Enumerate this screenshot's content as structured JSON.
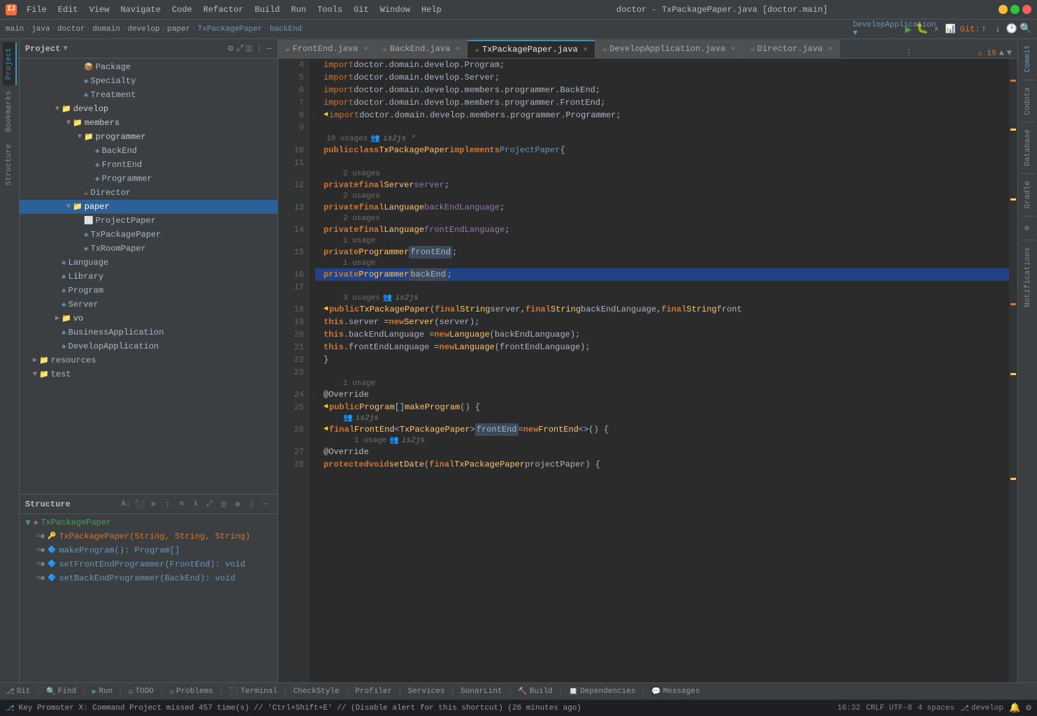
{
  "titleBar": {
    "title": "doctor - TxPackagePaper.java [doctor.main]",
    "menus": [
      "File",
      "Edit",
      "View",
      "Navigate",
      "Code",
      "Refactor",
      "Build",
      "Run",
      "Tools",
      "Git",
      "Window",
      "Help"
    ]
  },
  "breadcrumb": {
    "items": [
      "main",
      "java",
      "doctor",
      "domain",
      "develop",
      "paper",
      "TxPackagePaper",
      "backEnd"
    ]
  },
  "tabs": [
    {
      "label": "FrontEnd.java",
      "active": false,
      "modified": false,
      "icon": "☕"
    },
    {
      "label": "BackEnd.java",
      "active": false,
      "modified": false,
      "icon": "☕"
    },
    {
      "label": "TxPackagePaper.java",
      "active": true,
      "modified": false,
      "icon": "☕"
    },
    {
      "label": "DevelopApplication.java",
      "active": false,
      "modified": false,
      "icon": "☕"
    },
    {
      "label": "Director.java",
      "active": false,
      "modified": false,
      "icon": "☕"
    }
  ],
  "sidebar": {
    "title": "Project",
    "treeItems": [
      {
        "label": "Package",
        "indent": 5,
        "icon": "📦",
        "type": "file"
      },
      {
        "label": "Specialty",
        "indent": 5,
        "icon": "🔷",
        "type": "interface"
      },
      {
        "label": "Treatment",
        "indent": 5,
        "icon": "🔷",
        "type": "interface"
      },
      {
        "label": "develop",
        "indent": 3,
        "icon": "📁",
        "type": "folder",
        "expanded": true
      },
      {
        "label": "members",
        "indent": 5,
        "icon": "📁",
        "type": "folder-blue",
        "expanded": true
      },
      {
        "label": "programmer",
        "indent": 7,
        "icon": "📁",
        "type": "folder",
        "expanded": true
      },
      {
        "label": "BackEnd",
        "indent": 9,
        "icon": "🔷",
        "type": "interface"
      },
      {
        "label": "FrontEnd",
        "indent": 9,
        "icon": "🔷",
        "type": "interface"
      },
      {
        "label": "Programmer",
        "indent": 9,
        "icon": "🔷",
        "type": "interface"
      },
      {
        "label": "Director",
        "indent": 7,
        "icon": "☕",
        "type": "java"
      },
      {
        "label": "paper",
        "indent": 5,
        "icon": "📁",
        "type": "folder",
        "expanded": true,
        "selected": true
      },
      {
        "label": "ProjectPaper",
        "indent": 7,
        "icon": "🔲",
        "type": "interface2"
      },
      {
        "label": "TxPackagePaper",
        "indent": 7,
        "icon": "🔷",
        "type": "interface",
        "selected": true
      },
      {
        "label": "TxRoomPaper",
        "indent": 7,
        "icon": "🔷",
        "type": "interface"
      },
      {
        "label": "Language",
        "indent": 3,
        "icon": "🔷",
        "type": "interface"
      },
      {
        "label": "Library",
        "indent": 3,
        "icon": "🔷",
        "type": "interface"
      },
      {
        "label": "Program",
        "indent": 3,
        "icon": "🔷",
        "type": "interface"
      },
      {
        "label": "Server",
        "indent": 3,
        "icon": "🔷",
        "type": "interface"
      },
      {
        "label": "vo",
        "indent": 3,
        "icon": "📁",
        "type": "folder",
        "expanded": false
      },
      {
        "label": "BusinessApplication",
        "indent": 3,
        "icon": "🔷",
        "type": "interface"
      },
      {
        "label": "DevelopApplication",
        "indent": 3,
        "icon": "🔷",
        "type": "interface"
      },
      {
        "label": "resources",
        "indent": 1,
        "icon": "📁",
        "type": "resources"
      },
      {
        "label": "test",
        "indent": 1,
        "icon": "📁",
        "type": "test",
        "expanded": false
      }
    ]
  },
  "structure": {
    "title": "Structure",
    "rootLabel": "TxPackagePaper",
    "items": [
      {
        "label": "TxPackagePaper(String, String, String)",
        "type": "constructor",
        "indent": 1
      },
      {
        "label": "makeProgram(): Program[]",
        "type": "method",
        "indent": 1
      },
      {
        "label": "setFrontEndProgrammer(FrontEnd): void",
        "type": "method-public",
        "indent": 1
      },
      {
        "label": "setBackEndProgrammer(BackEnd): void",
        "type": "method-public",
        "indent": 1
      }
    ]
  },
  "editor": {
    "filename": "TxPackagePaper.java",
    "warningCount": 19,
    "lines": [
      {
        "num": 4,
        "meta": null,
        "code": "import",
        "codeFull": "    import doctor.domain.develop.Program;"
      },
      {
        "num": 5,
        "meta": null,
        "codeFull": "    import doctor.domain.develop.Server;"
      },
      {
        "num": 6,
        "meta": null,
        "codeFull": "    import doctor.domain.develop.members.programmer.BackEnd;"
      },
      {
        "num": 7,
        "meta": null,
        "codeFull": "    import doctor.domain.develop.members.programmer.FrontEnd;"
      },
      {
        "num": 8,
        "meta": null,
        "codeFull": "    import doctor.domain.develop.members.programmer.Programmer;"
      },
      {
        "num": 9,
        "meta": null,
        "codeFull": ""
      },
      {
        "num": 10,
        "meta": "10 usages  is2js *",
        "codeFull": "public class TxPackagePaper implements ProjectPaper {"
      },
      {
        "num": 11,
        "meta": null,
        "codeFull": ""
      },
      {
        "num": 12,
        "meta": "2 usages",
        "codeFull": "    private final Server server;"
      },
      {
        "num": 13,
        "meta": "2 usages",
        "codeFull": "    private final Language backEndLanguage;"
      },
      {
        "num": 14,
        "meta": "2 usages",
        "codeFull": "    private final Language frontEndLanguage;"
      },
      {
        "num": 15,
        "meta": "1 usage",
        "codeFull": "    private Programmer frontEnd;"
      },
      {
        "num": 16,
        "meta": "1 usage",
        "codeFull": "    private Programmer backEnd;"
      },
      {
        "num": 17,
        "meta": null,
        "codeFull": ""
      },
      {
        "num": 18,
        "meta": "3 usages  is2js",
        "codeFull": "    public TxPackagePaper(final String server, final String backEndLanguage, final String front"
      },
      {
        "num": 19,
        "meta": null,
        "codeFull": "        this.server = new Server(server);"
      },
      {
        "num": 20,
        "meta": null,
        "codeFull": "        this.backEndLanguage = new Language(backEndLanguage);"
      },
      {
        "num": 21,
        "meta": null,
        "codeFull": "        this.frontEndLanguage = new Language(frontEndLanguage);"
      },
      {
        "num": 22,
        "meta": null,
        "codeFull": "    }"
      },
      {
        "num": 23,
        "meta": null,
        "codeFull": ""
      },
      {
        "num": 24,
        "meta": "1 usage",
        "codeFull": "    @Override"
      },
      {
        "num": 25,
        "meta": null,
        "codeFull": "    public Program[] makeProgram() {"
      },
      {
        "num": 26,
        "meta": "is2js",
        "codeFull": "        final FrontEnd<TxPackagePaper> frontEnd = new FrontEnd<>() {"
      },
      {
        "num": 27,
        "meta": "1 usage  is2js",
        "codeFull": "            @Override"
      },
      {
        "num": 28,
        "meta": null,
        "codeFull": "            protected void setDate(final TxPackagePaper projectPaper) {"
      }
    ]
  },
  "bottomBar": {
    "git": "Git",
    "find": "Find",
    "run": "Run",
    "todo": "TODO",
    "problems": "Problems",
    "terminal": "Terminal",
    "checkstyle": "CheckStyle",
    "profiler": "Profiler",
    "services": "Services",
    "sonarlint": "SonarLint",
    "build": "Build",
    "dependencies": "Dependencies",
    "messages": "Messages"
  },
  "statusBar": {
    "message": "Key Promoter X: Command Project missed 457 time(s) // 'Ctrl+Shift+E' // (Disable alert for this shortcut) (26 minutes ago)",
    "position": "16:32",
    "encoding": "CRLF  UTF-8",
    "indent": "4 spaces",
    "branch": "⎇ develop"
  },
  "rightSidebar": {
    "tabs": [
      "Commit",
      "Codota",
      "Database",
      "Gradle",
      "⚙",
      "Notifications"
    ]
  },
  "leftPanelTabs": [
    "Project",
    "Bookmarks",
    "Structure"
  ]
}
